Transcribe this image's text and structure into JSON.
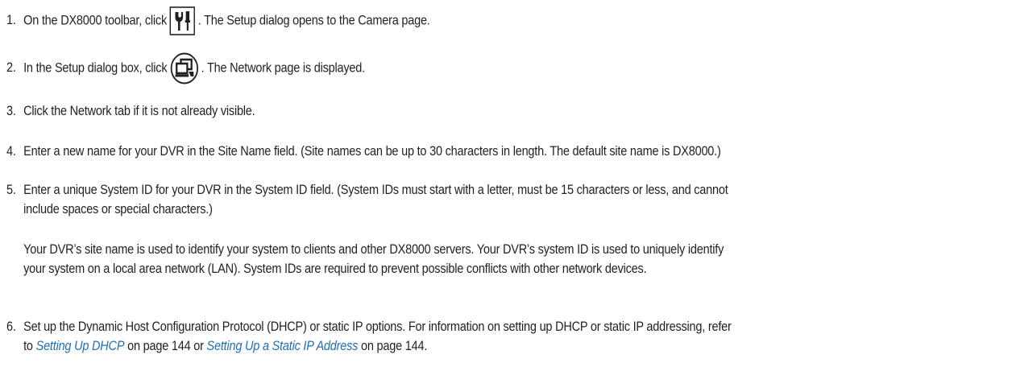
{
  "steps": [
    {
      "number": "1.",
      "before_icon": "On the DX8000 toolbar, click",
      "icon": "tools-icon",
      "after_icon": ". The Setup dialog opens to the Camera page."
    },
    {
      "number": "2.",
      "before_icon": "In the Setup dialog box, click",
      "icon": "network-computer-icon",
      "after_icon": ". The Network page is displayed."
    },
    {
      "number": "3.",
      "text": "Click the Network tab if it is not already visible."
    },
    {
      "number": "4.",
      "text": "Enter a new name for your DVR in the Site Name field. (Site names can be up to 30 characters in length. The default site name is DX8000.)"
    },
    {
      "number": "5.",
      "line1": "Enter a unique System ID for your DVR in the System ID field. (System IDs must start with a letter, must be 15 characters or less, and cannot",
      "line2": "include spaces or special characters.)"
    },
    {
      "number": "6.",
      "line1": "Set up the Dynamic Host Configuration Protocol (DHCP) or static IP options. For information on setting up DHCP or static IP addressing, refer",
      "line2_prefix": "to ",
      "link1": "Setting Up DHCP",
      "middle": " on page 144 or ",
      "link2": "Setting Up a Static IP Address",
      "suffix": " on page 144."
    }
  ],
  "note": {
    "line1": "Your DVR’s site name is used to identify your system to clients and other DX8000 servers. Your DVR’s system ID is used to uniquely identify",
    "line2": "your system on a local area network (LAN). System IDs are required to prevent possible conflicts with other network devices."
  },
  "colors": {
    "text": "#231f20",
    "link": "#1f6fb4"
  }
}
